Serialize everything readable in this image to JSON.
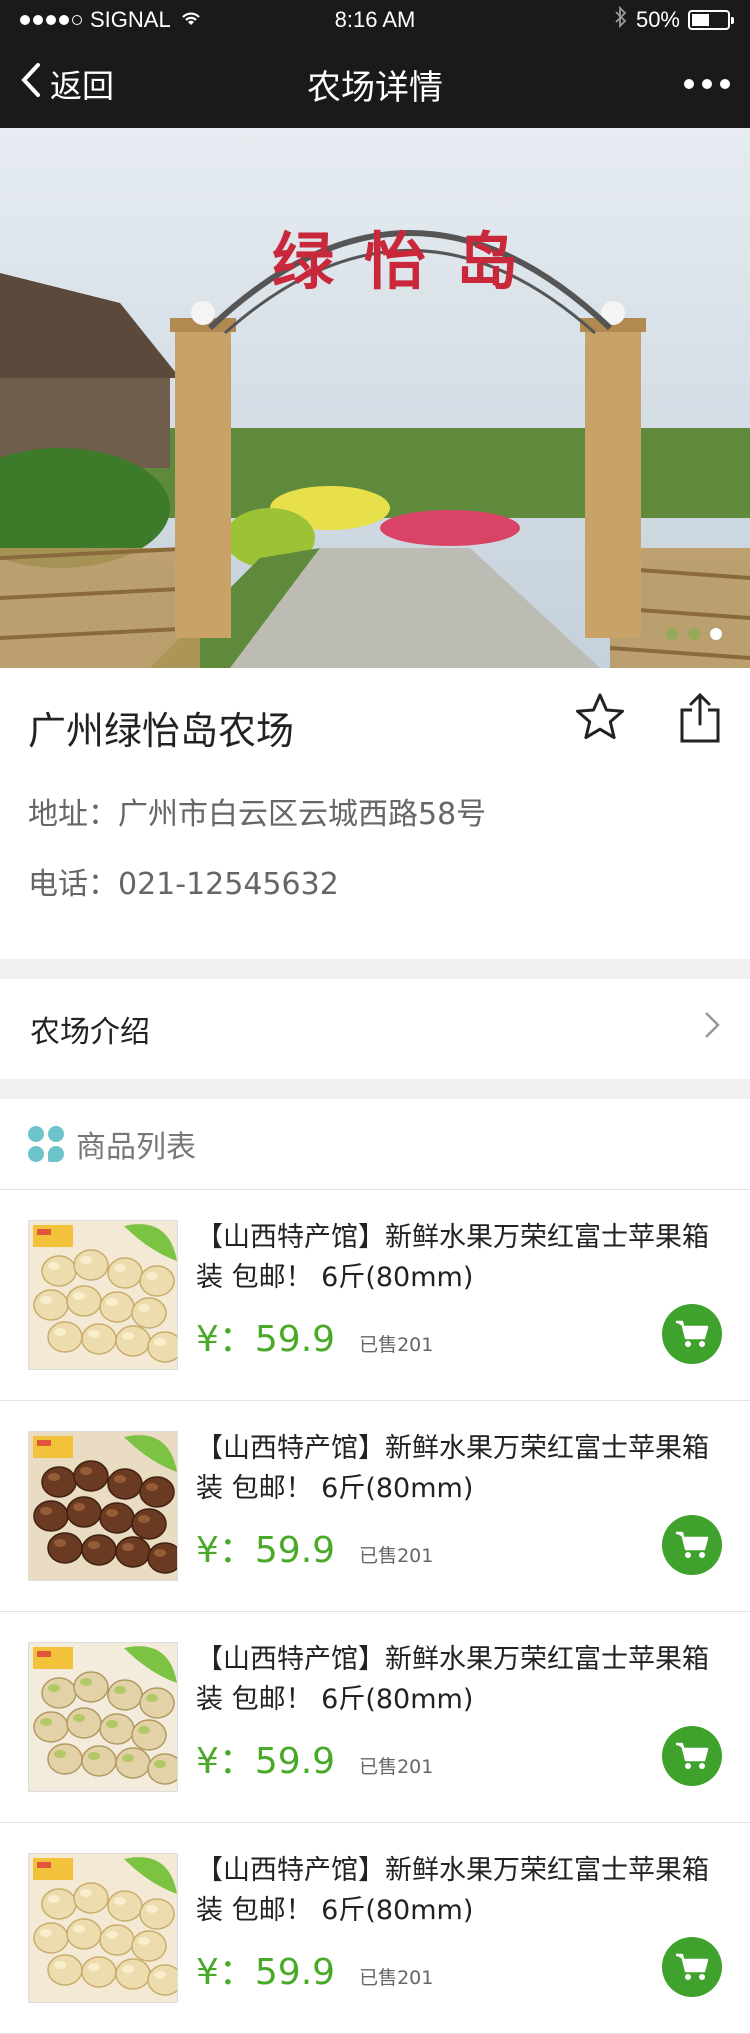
{
  "status": {
    "carrier": "SIGNAL",
    "time": "8:16 AM",
    "battery": "50%",
    "battery_level": 0.5
  },
  "nav": {
    "back_label": "返回",
    "title": "农场详情"
  },
  "hero": {
    "sign_text": "绿怡岛",
    "slides": 3,
    "active_slide": 3
  },
  "farm": {
    "name": "广州绿怡岛农场",
    "address": "地址：广州市白云区云城西路58号",
    "phone": "电话：021-12545632"
  },
  "intro": {
    "label": "农场介绍"
  },
  "products": {
    "header": "商品列表",
    "items": [
      {
        "title": "【山西特产馆】新鲜水果万荣红富士苹果箱装 包邮！ 6斤(80mm)",
        "price": "¥：59.9",
        "sold": "已售201",
        "image": "macadamia"
      },
      {
        "title": "【山西特产馆】新鲜水果万荣红富士苹果箱装 包邮！ 6斤(80mm)",
        "price": "¥：59.9",
        "sold": "已售201",
        "image": "pecan"
      },
      {
        "title": "【山西特产馆】新鲜水果万荣红富士苹果箱装 包邮！ 6斤(80mm)",
        "price": "¥：59.9",
        "sold": "已售201",
        "image": "pistachio"
      },
      {
        "title": "【山西特产馆】新鲜水果万荣红富士苹果箱装 包邮！ 6斤(80mm)",
        "price": "¥：59.9",
        "sold": "已售201",
        "image": "macadamia"
      }
    ]
  },
  "colors": {
    "accent": "#4aa928",
    "nav_bg": "#1a1a1a",
    "icon_teal": "#6cc3c9"
  }
}
